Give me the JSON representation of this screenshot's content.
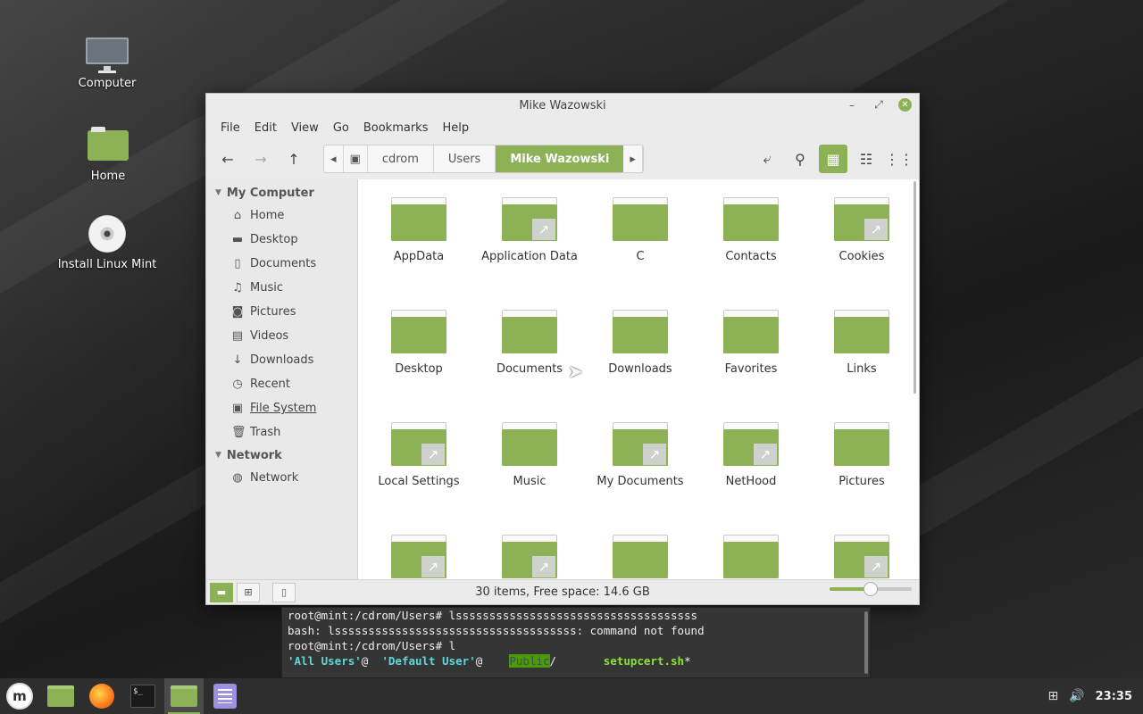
{
  "desktop": {
    "icons": [
      {
        "label": "Computer"
      },
      {
        "label": "Home"
      },
      {
        "label": "Install Linux Mint"
      }
    ]
  },
  "window": {
    "title": "Mike Wazowski",
    "menu": [
      "File",
      "Edit",
      "View",
      "Go",
      "Bookmarks",
      "Help"
    ],
    "path": [
      "cdrom",
      "Users",
      "Mike Wazowski"
    ],
    "sidebar": {
      "sections": [
        {
          "label": "My Computer",
          "items": [
            {
              "label": "Home",
              "icon": "home-icon"
            },
            {
              "label": "Desktop",
              "icon": "desktop-icon"
            },
            {
              "label": "Documents",
              "icon": "document-icon"
            },
            {
              "label": "Music",
              "icon": "music-icon"
            },
            {
              "label": "Pictures",
              "icon": "camera-icon"
            },
            {
              "label": "Videos",
              "icon": "film-icon"
            },
            {
              "label": "Downloads",
              "icon": "download-icon"
            },
            {
              "label": "Recent",
              "icon": "clock-icon"
            },
            {
              "label": "File System",
              "icon": "drive-icon"
            },
            {
              "label": "Trash",
              "icon": "trash-icon"
            }
          ]
        },
        {
          "label": "Network",
          "items": [
            {
              "label": "Network",
              "icon": "globe-icon"
            }
          ]
        }
      ]
    },
    "files": [
      {
        "name": "AppData",
        "link": false
      },
      {
        "name": "Application Data",
        "link": true
      },
      {
        "name": "C",
        "link": false
      },
      {
        "name": "Contacts",
        "link": false
      },
      {
        "name": "Cookies",
        "link": true
      },
      {
        "name": "Desktop",
        "link": false
      },
      {
        "name": "Documents",
        "link": false
      },
      {
        "name": "Downloads",
        "link": false
      },
      {
        "name": "Favorites",
        "link": false
      },
      {
        "name": "Links",
        "link": false
      },
      {
        "name": "Local Settings",
        "link": true
      },
      {
        "name": "Music",
        "link": false
      },
      {
        "name": "My Documents",
        "link": true
      },
      {
        "name": "NetHood",
        "link": true
      },
      {
        "name": "Pictures",
        "link": false
      },
      {
        "name": "",
        "link": true
      },
      {
        "name": "",
        "link": true
      },
      {
        "name": "",
        "link": false
      },
      {
        "name": "",
        "link": false
      },
      {
        "name": "",
        "link": true
      }
    ],
    "status": "30 items, Free space: 14.6 GB",
    "zoom_level": 0.5,
    "accent": "#8db256"
  },
  "terminal": {
    "lines": [
      "root@mint:/cdrom/Users# lssssssssssssssssssssssssssssssssssss",
      "bash: lssssssssssssssssssssssssssssssssssss: command not found",
      "root@mint:/cdrom/Users# l"
    ],
    "listing": {
      "a": "'All Users'",
      "a_suffix": "@  ",
      "b": "'Default User'",
      "b_suffix": "@    ",
      "c": "Public",
      "c_suffix": "/       ",
      "d": "setupcert.sh",
      "d_suffix": "*"
    }
  },
  "taskbar": {
    "clock": "23:35",
    "menu_label": "m"
  }
}
